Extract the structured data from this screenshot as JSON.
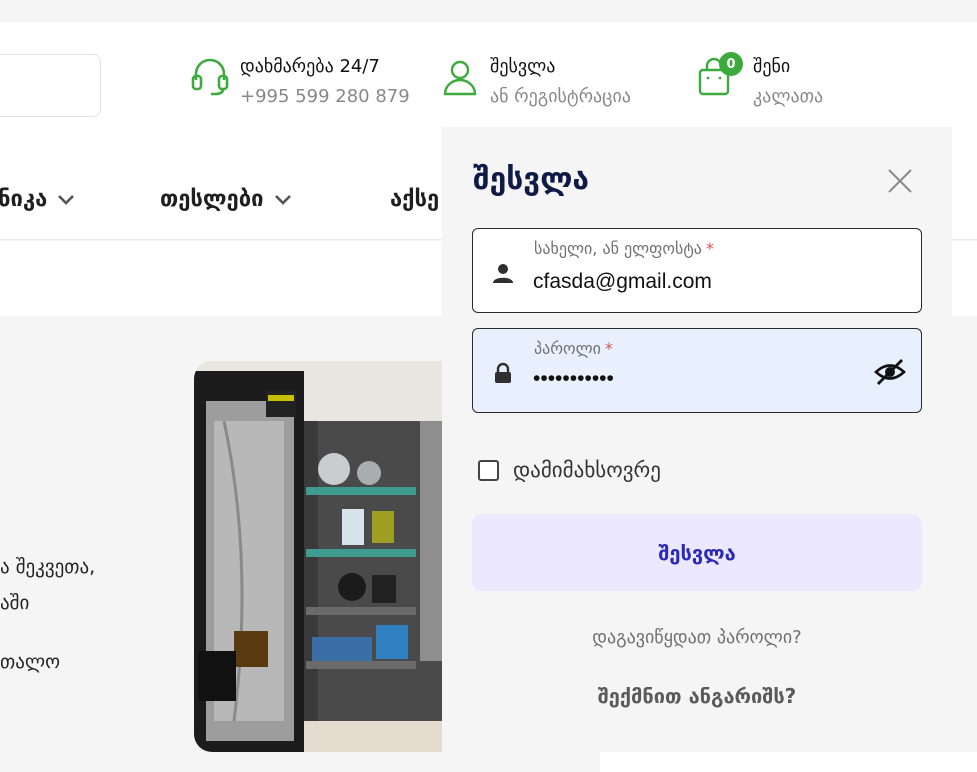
{
  "colors": {
    "brand_green": "#3caa3c",
    "login_title": "#0e1b47",
    "login_button_text": "#2a28b8",
    "login_button_bg": "#ece8fd"
  },
  "header": {
    "help": {
      "icon": "headset-icon",
      "title": "დახმარება 24/7",
      "phone": "+995 599 280 879"
    },
    "account": {
      "icon": "user-icon",
      "title": "შესვლა",
      "subtitle": "ან რეგისტრაცია"
    },
    "cart": {
      "icon": "shopping-bag-icon",
      "count": "0",
      "title": "შენი",
      "subtitle": "კალათა"
    }
  },
  "nav": {
    "items": [
      {
        "label": "ნიკა"
      },
      {
        "label": "თესლები"
      },
      {
        "label": "აქსე"
      }
    ]
  },
  "content": {
    "lines": [
      "ა შეკვეთა,",
      "აში",
      "თალო"
    ]
  },
  "login": {
    "title": "შესვლა",
    "username": {
      "label": "სახელი, ან ელფოსტა",
      "required_mark": "*",
      "value": "cfasda@gmail.com"
    },
    "password": {
      "label": "პაროლი",
      "required_mark": "*",
      "masked_value": "•••••••••••"
    },
    "remember_label": "დამიმახსოვრე",
    "submit_label": "შესვლა",
    "forgot_label": "დაგავიწყდათ პაროლი?",
    "register_label": "შექმნით ანგარიშს?"
  }
}
